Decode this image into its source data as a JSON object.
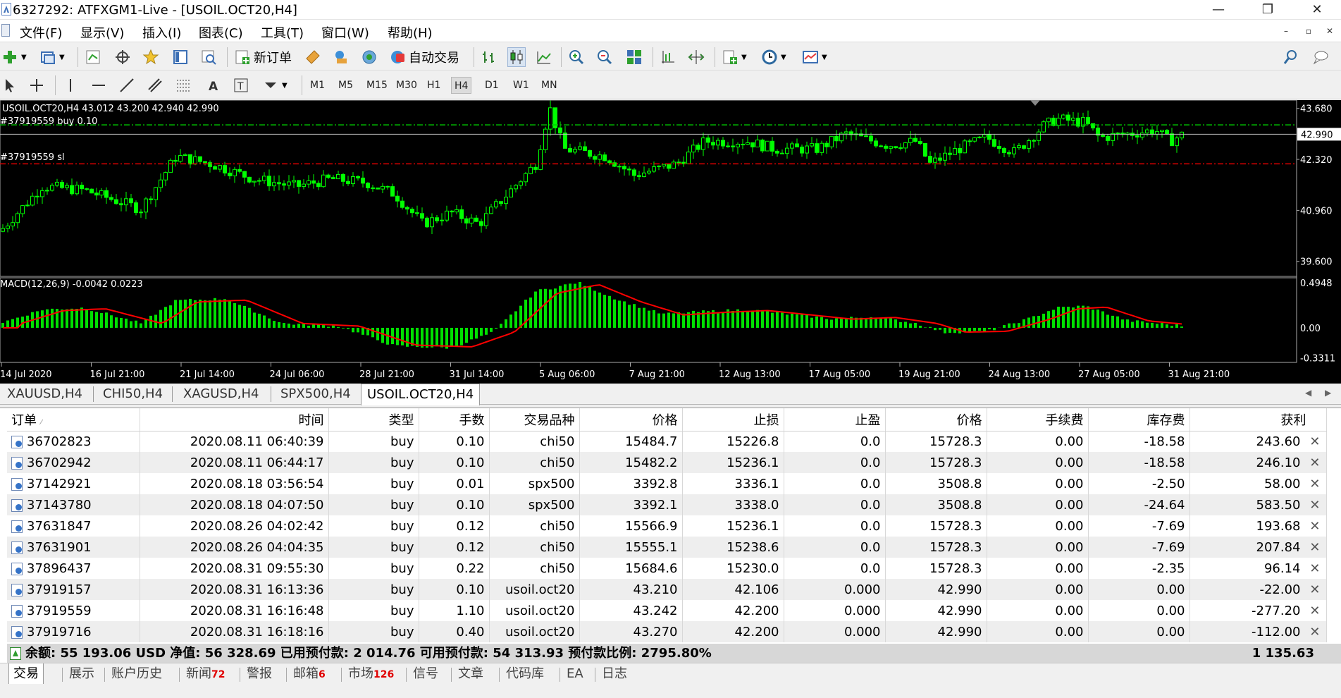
{
  "window": {
    "title": "6327292: ATFXGM1-Live - [USOIL.OCT20,H4]",
    "minimize": "—",
    "maximize": "❐",
    "close": "✕"
  },
  "menu": [
    "文件(F)",
    "显示(V)",
    "插入(I)",
    "图表(C)",
    "工具(T)",
    "窗口(W)",
    "帮助(H)"
  ],
  "toolbar": {
    "new_order": "新订单",
    "auto_trade": "自动交易",
    "icons": [
      "new-chart-icon",
      "profiles-icon",
      "market-watch-icon",
      "navigator-icon",
      "favorites-icon",
      "data-window-icon",
      "strategy-tester-icon",
      "new-order-icon",
      "metaeditor-icon",
      "signals-icon",
      "vps-icon",
      "auto-trading-icon",
      "bar-chart-icon",
      "candlestick-icon",
      "line-chart-icon",
      "zoom-in-icon",
      "zoom-out-icon",
      "tile-windows-icon",
      "chart-shift-icon",
      "auto-scroll-icon",
      "indicators-icon",
      "periods-icon",
      "templates-icon",
      "search-icon",
      "chat-icon"
    ]
  },
  "timeframes": [
    "M1",
    "M5",
    "M15",
    "M30",
    "H1",
    "H4",
    "D1",
    "W1",
    "MN"
  ],
  "active_timeframe": "H4",
  "chart": {
    "symbol_info": "USOIL.OCT20,H4  43.012 43.200 42.940 42.990",
    "order_label_1": "#37919559 buy 0.10",
    "order_label_2": "#37919559 sl",
    "macd_info": "MACD(12,26,9) -0.0042 0.0223",
    "current_price": "42.990",
    "price_ticks": [
      "43.680",
      "42.320",
      "40.960",
      "39.600"
    ],
    "macd_ticks": [
      "0.4948",
      "0.00",
      "-0.3311"
    ],
    "time_labels": [
      "14 Jul 2020",
      "16 Jul 21:00",
      "21 Jul 14:00",
      "24 Jul 06:00",
      "28 Jul 21:00",
      "31 Jul 14:00",
      "5 Aug 06:00",
      "7 Aug 21:00",
      "12 Aug 13:00",
      "17 Aug 05:00",
      "19 Aug 21:00",
      "24 Aug 13:00",
      "27 Aug 05:00",
      "31 Aug 21:00"
    ],
    "colors": {
      "bull": "#00ff00",
      "bear": "#00ff00",
      "macd_hist": "#00e000",
      "signal": "#ff0000",
      "order_line": "#00c000",
      "sl_line": "#e00000"
    }
  },
  "chart_tabs": [
    "XAUUSD,H4",
    "CHI50,H4",
    "XAGUSD,H4",
    "SPX500,H4",
    "USOIL.OCT20,H4"
  ],
  "active_chart_tab": "USOIL.OCT20,H4",
  "orders_table": {
    "headers": [
      "订单",
      "时间",
      "类型",
      "手数",
      "交易品种",
      "价格",
      "止损",
      "止盈",
      "价格",
      "手续费",
      "库存费",
      "获利"
    ],
    "rows": [
      [
        "36702823",
        "2020.08.11 06:40:39",
        "buy",
        "0.10",
        "chi50",
        "15484.7",
        "15226.8",
        "0.0",
        "15728.3",
        "0.00",
        "-18.58",
        "243.60"
      ],
      [
        "36702942",
        "2020.08.11 06:44:17",
        "buy",
        "0.10",
        "chi50",
        "15482.2",
        "15236.1",
        "0.0",
        "15728.3",
        "0.00",
        "-18.58",
        "246.10"
      ],
      [
        "37142921",
        "2020.08.18 03:56:54",
        "buy",
        "0.01",
        "spx500",
        "3392.8",
        "3336.1",
        "0.0",
        "3508.8",
        "0.00",
        "-2.50",
        "58.00"
      ],
      [
        "37143780",
        "2020.08.18 04:07:50",
        "buy",
        "0.10",
        "spx500",
        "3392.1",
        "3338.0",
        "0.0",
        "3508.8",
        "0.00",
        "-24.64",
        "583.50"
      ],
      [
        "37631847",
        "2020.08.26 04:02:42",
        "buy",
        "0.12",
        "chi50",
        "15566.9",
        "15236.1",
        "0.0",
        "15728.3",
        "0.00",
        "-7.69",
        "193.68"
      ],
      [
        "37631901",
        "2020.08.26 04:04:35",
        "buy",
        "0.12",
        "chi50",
        "15555.1",
        "15238.6",
        "0.0",
        "15728.3",
        "0.00",
        "-7.69",
        "207.84"
      ],
      [
        "37896437",
        "2020.08.31 09:55:30",
        "buy",
        "0.22",
        "chi50",
        "15684.6",
        "15230.0",
        "0.0",
        "15728.3",
        "0.00",
        "-2.35",
        "96.14"
      ],
      [
        "37919157",
        "2020.08.31 16:13:36",
        "buy",
        "0.10",
        "usoil.oct20",
        "43.210",
        "42.106",
        "0.000",
        "42.990",
        "0.00",
        "0.00",
        "-22.00"
      ],
      [
        "37919559",
        "2020.08.31 16:16:48",
        "buy",
        "1.10",
        "usoil.oct20",
        "43.242",
        "42.200",
        "0.000",
        "42.990",
        "0.00",
        "0.00",
        "-277.20"
      ],
      [
        "37919716",
        "2020.08.31 16:18:16",
        "buy",
        "0.40",
        "usoil.oct20",
        "43.270",
        "42.200",
        "0.000",
        "42.990",
        "0.00",
        "0.00",
        "-112.00"
      ]
    ]
  },
  "balance": {
    "summary": "余额: 55 193.06 USD  净值: 56 328.69  已用预付款: 2 014.76  可用预付款: 54 313.93  预付款比例: 2795.80%",
    "total": "1 135.63"
  },
  "bottom_tabs": [
    {
      "label": "交易",
      "count": ""
    },
    {
      "label": "展示",
      "count": ""
    },
    {
      "label": "账户历史",
      "count": ""
    },
    {
      "label": "新闻",
      "count": "72"
    },
    {
      "label": "警报",
      "count": ""
    },
    {
      "label": "邮箱",
      "count": "6"
    },
    {
      "label": "市场",
      "count": "126"
    },
    {
      "label": "信号",
      "count": ""
    },
    {
      "label": "文章",
      "count": ""
    },
    {
      "label": "代码库",
      "count": ""
    },
    {
      "label": "EA",
      "count": ""
    },
    {
      "label": "日志",
      "count": ""
    }
  ]
}
